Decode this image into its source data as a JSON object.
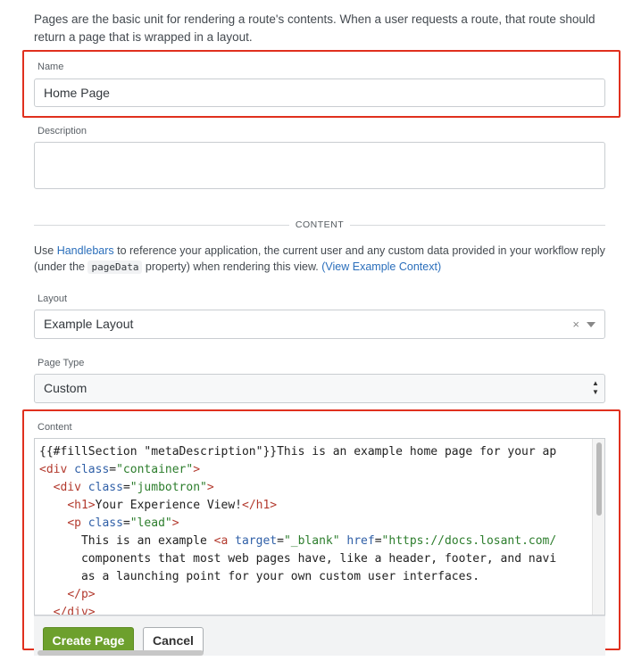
{
  "intro": "Pages are the basic unit for rendering a route's contents. When a user requests a route, that route should return a page that is wrapped in a layout.",
  "name": {
    "label": "Name",
    "value": "Home Page"
  },
  "description": {
    "label": "Description",
    "value": ""
  },
  "divider": "CONTENT",
  "help": {
    "prefix": "Use ",
    "link_handlebars": "Handlebars",
    "middle": " to reference your application, the current user and any custom data provided in your workflow reply (under the ",
    "code": "pageData",
    "suffix": " property) when rendering this view. ",
    "link_context": "(View Example Context)"
  },
  "layout": {
    "label": "Layout",
    "value": "Example Layout",
    "clear_glyph": "×"
  },
  "page_type": {
    "label": "Page Type",
    "value": "Custom"
  },
  "content": {
    "label": "Content",
    "lines": [
      "{{#fillSection \"metaDescription\"}}This is an example home page for your ap",
      "<div class=\"container\">",
      "  <div class=\"jumbotron\">",
      "    <h1>Your Experience View!</h1>",
      "    <p class=\"lead\">",
      "      This is an example <a target=\"_blank\" href=\"https://docs.losant.com/",
      "      components that most web pages have, like a header, footer, and navi",
      "      as a launching point for your own custom user interfaces.",
      "    </p>",
      "  </div>"
    ]
  },
  "buttons": {
    "create": "Create Page",
    "cancel": "Cancel"
  },
  "colors": {
    "highlight": "#e0301e",
    "primary_button": "#6da02d",
    "link": "#2a6ebb"
  }
}
